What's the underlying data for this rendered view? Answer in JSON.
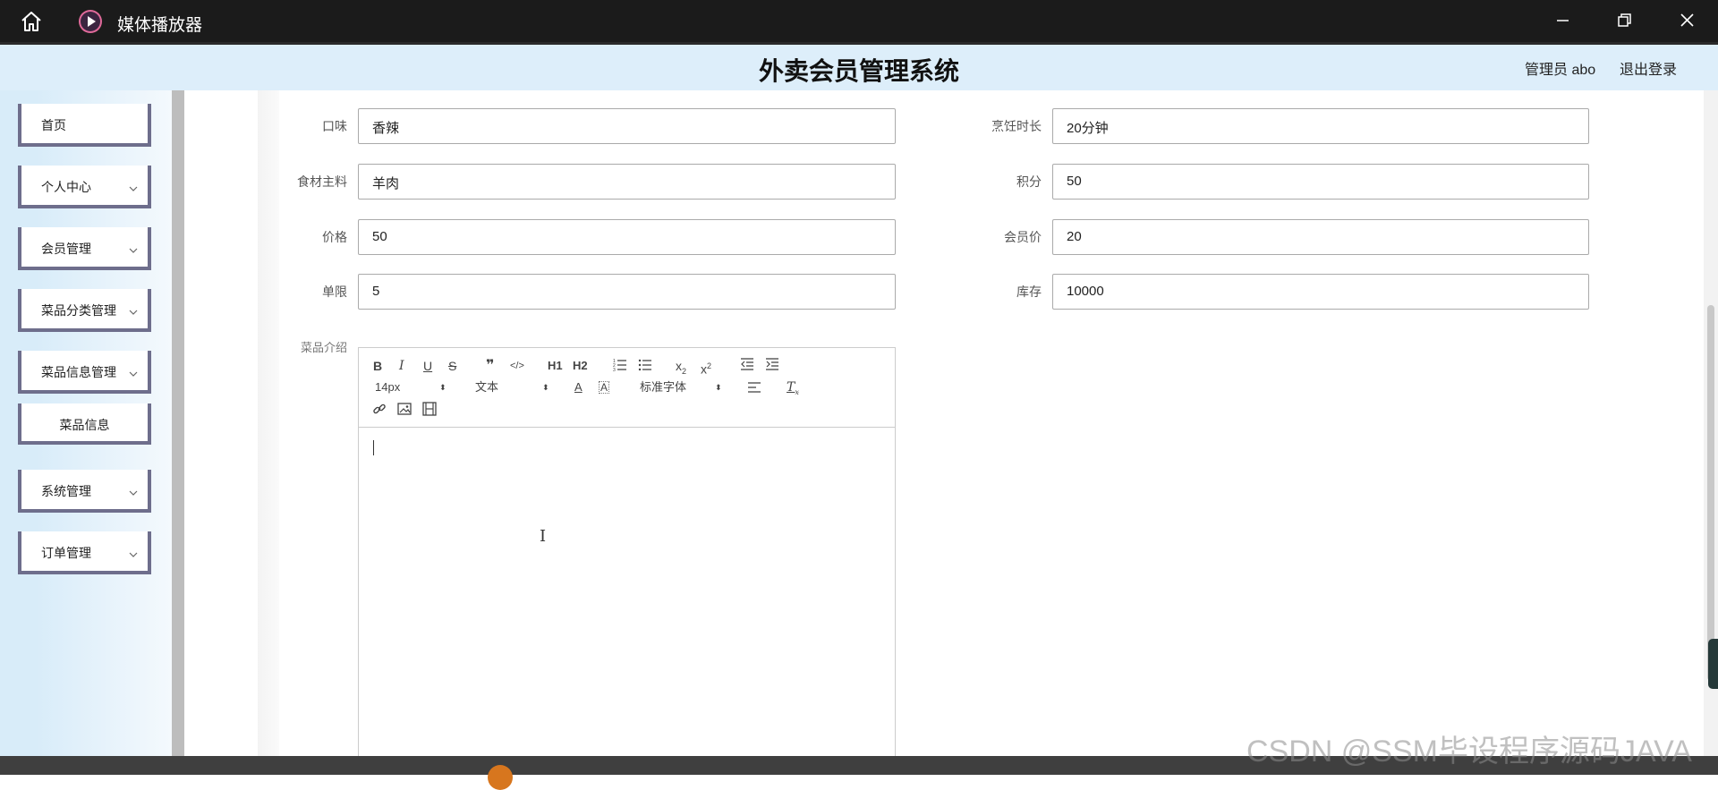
{
  "player": {
    "title": "媒体播放器"
  },
  "header": {
    "system_title": "外卖会员管理系统",
    "admin_label": "管理员 abo",
    "logout_label": "退出登录"
  },
  "sidebar": {
    "items": [
      {
        "label": "首页"
      },
      {
        "label": "个人中心"
      },
      {
        "label": "会员管理"
      },
      {
        "label": "菜品分类管理"
      },
      {
        "label": "菜品信息管理"
      },
      {
        "label": "菜品信息"
      },
      {
        "label": "系统管理"
      },
      {
        "label": "订单管理"
      }
    ]
  },
  "form": {
    "taste": {
      "label": "口味",
      "value": "香辣"
    },
    "cook_time": {
      "label": "烹饪时长",
      "value": "20分钟"
    },
    "ingredients": {
      "label": "食材主料",
      "value": "羊肉"
    },
    "points": {
      "label": "积分",
      "value": "50"
    },
    "price": {
      "label": "价格",
      "value": "50"
    },
    "member_price": {
      "label": "会员价",
      "value": "20"
    },
    "limit": {
      "label": "单限",
      "value": "5"
    },
    "stock": {
      "label": "库存",
      "value": "10000"
    },
    "intro": {
      "label": "菜品介绍"
    }
  },
  "editor": {
    "font_size": "14px",
    "format": "文本",
    "font_family": "标准字体",
    "heading1": "H1",
    "heading2": "H2"
  },
  "watermark": "CSDN @SSM毕设程序源码JAVA",
  "colors": {
    "menu_border": "#6e6e8c",
    "header_bg": "#ddeefa",
    "sidebar_bg": "#d8ecf9"
  }
}
